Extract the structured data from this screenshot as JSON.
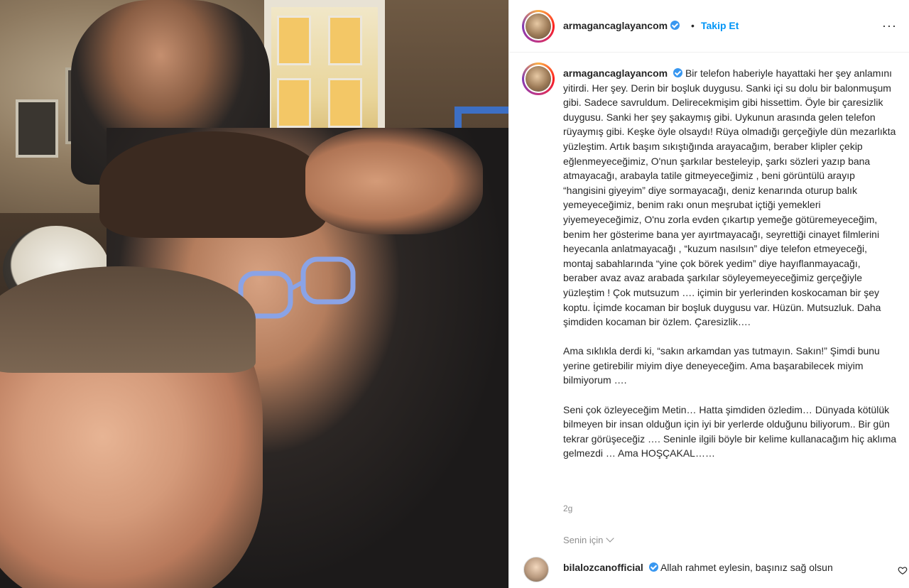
{
  "header": {
    "username": "armagancaglayancom",
    "separator": "•",
    "follow_label": "Takip Et",
    "more_label": "···"
  },
  "caption": {
    "username": "armagancaglayancom",
    "paragraphs": [
      "Bir telefon haberiyle hayattaki her şey anlamını yitirdi. Her şey. Derin bir boşluk duygusu. Sanki içi su dolu bir balonmuşum gibi. Sadece savruldum. Delirecekmişim gibi hissettim. Öyle bir çaresizlik duygusu. Sanki her şey şakaymış gibi. Uykunun arasında gelen telefon rüyaymış gibi. Keşke öyle olsaydı! Rüya olmadığı gerçeğiyle dün mezarlıkta yüzleştim. Artık başım sıkıştığında arayacağım, beraber klipler çekip eğlenmeyeceğimiz, O'nun şarkılar besteleyip, şarkı sözleri yazıp bana atmayacağı, arabayla tatile gitmeyeceğimiz , beni görüntülü arayıp “hangisini giyeyim” diye sormayacağı, deniz kenarında oturup balık yemeyeceğimiz, benim rakı onun meşrubat içtiği yemekleri yiyemeyeceğimiz, O'nu zorla evden çıkartıp yemeğe götüremeyeceğim, benim her gösterime bana yer ayırtmayacağı, seyrettiği cinayet filmlerini heyecanla anlatmayacağı , “kuzum nasılsın” diye telefon etmeyeceği, montaj sabahlarında “yine çok börek yedim” diye hayıflanmayacağı, beraber avaz avaz arabada şarkılar söyleyemeyeceğimiz gerçeğiyle yüzleştim ! Çok mutsuzum …. içimin bir yerlerinden koskocaman bir şey koptu. İçimde kocaman bir boşluk duygusu var. Hüzün. Mutsuzluk. Daha şimdiden kocaman bir özlem. Çaresizlik….",
      "Ama sıklıkla derdi ki, “sakın arkamdan yas tutmayın. Sakın!” Şimdi bunu yerine getirebilir miyim diye deneyeceğim. Ama başarabilecek miyim bilmiyorum ….",
      "Seni çok özleyeceğim Metin… Hatta şimdiden özledim… Dünyada kötülük bilmeyen bir insan olduğun için iyi bir yerlerde olduğunu biliyorum.. Bir gün tekrar görüşeceğiz …. Seninle ilgili böyle bir kelime kullanacağım hiç aklıma gelmezdi … Ama HOŞÇAKAL……"
    ]
  },
  "post_age": "2g",
  "for_you_label": "Senin için",
  "comment": {
    "username": "bilalozcanofficial",
    "text": "Allah rahmet eylesin, başınız sağ olsun"
  },
  "colors": {
    "accent": "#0095f6",
    "verified": "#3897f0",
    "muted": "#8e8e8e",
    "text": "#262626"
  },
  "icons": [
    "verified-badge-icon",
    "more-options-icon",
    "chevron-down-icon",
    "heart-icon"
  ]
}
